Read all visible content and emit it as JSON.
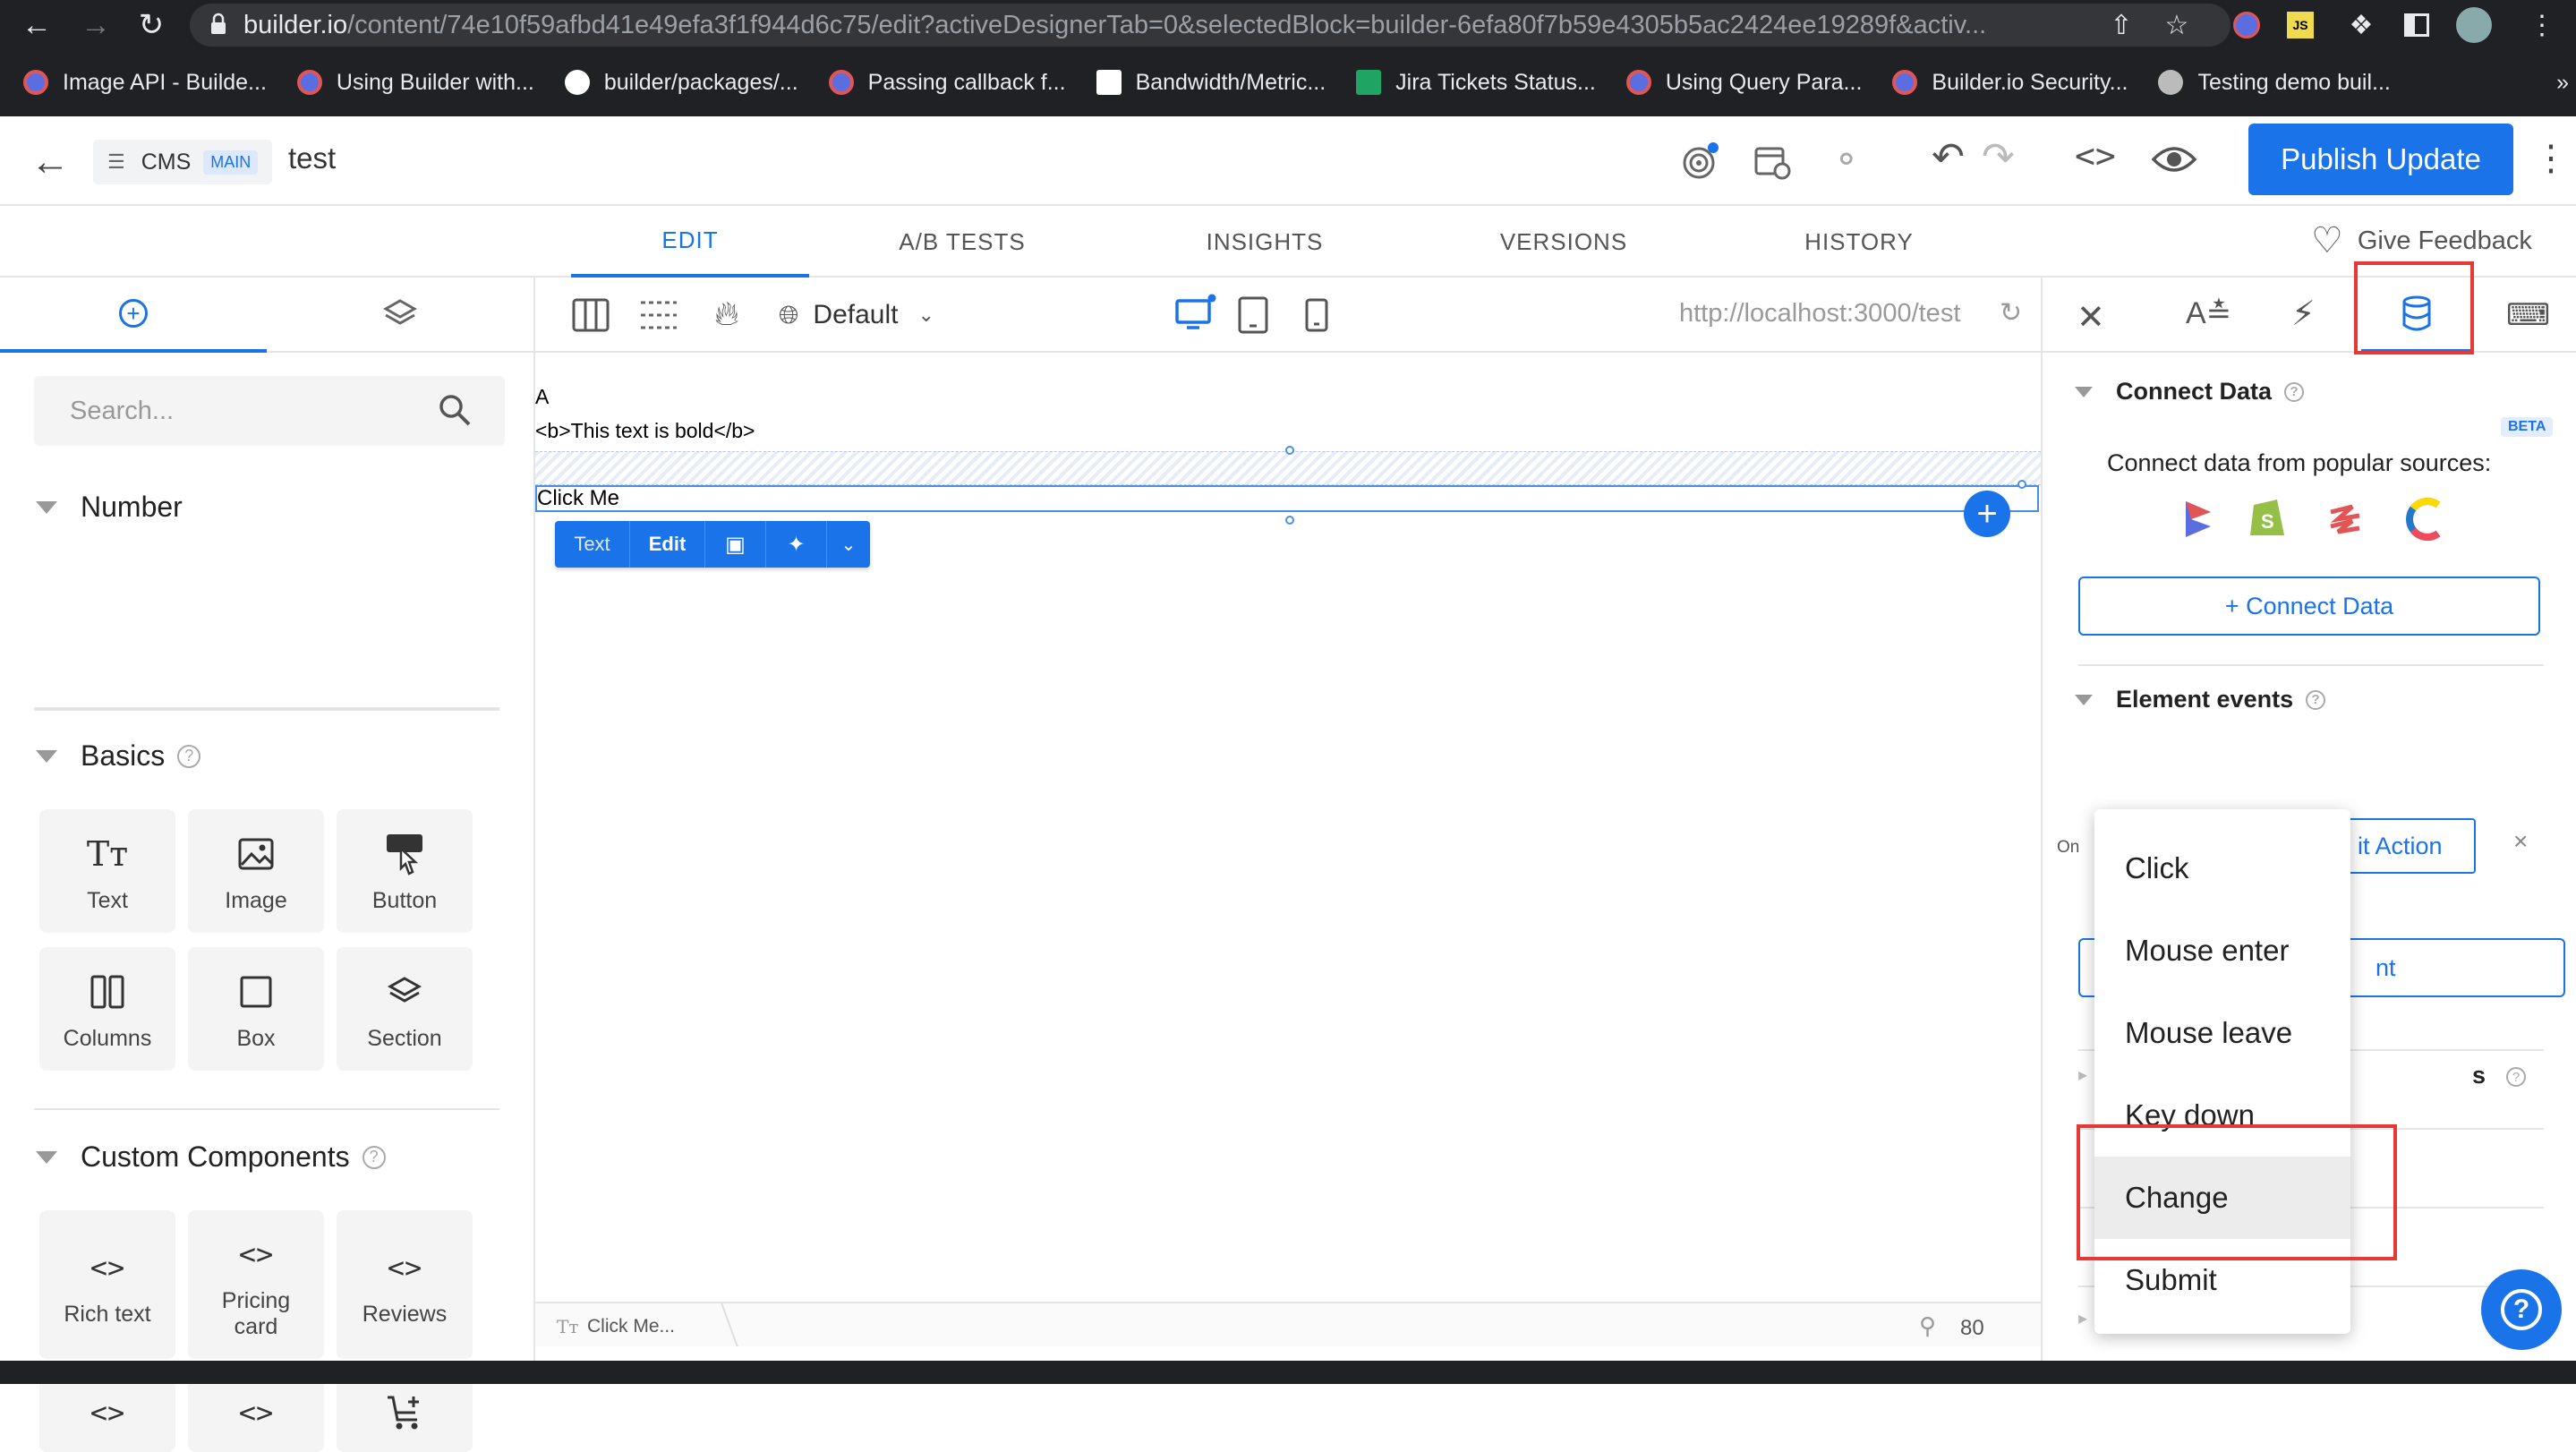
{
  "browser": {
    "url_host": "builder.io",
    "url_path": "/content/74e10f59afbd41e49efa3f1f944d6c75/edit?activeDesignerTab=0&selectedBlock=builder-6efa80f7b59e4305b5ac2424ee19289f&activ...",
    "bookmarks": [
      {
        "label": "Image API - Builde...",
        "color": "#e25555"
      },
      {
        "label": "Using Builder with...",
        "color": "#e25555"
      },
      {
        "label": "builder/packages/...",
        "color": "#ffffff"
      },
      {
        "label": "Passing callback f...",
        "color": "#e25555"
      },
      {
        "label": "Bandwidth/Metric...",
        "color": "#ffffff"
      },
      {
        "label": "Jira Tickets Status...",
        "color": "#1fa463"
      },
      {
        "label": "Using Query Para...",
        "color": "#e25555"
      },
      {
        "label": "Builder.io Security...",
        "color": "#e25555"
      },
      {
        "label": "Testing demo buil...",
        "color": "#bbbbbb"
      }
    ],
    "more": "»"
  },
  "header": {
    "cms_label": "CMS",
    "main_badge": "MAIN",
    "title": "test",
    "publish_label": "Publish Update",
    "accent": "#1a73e8"
  },
  "tabs": [
    "EDIT",
    "A/B TESTS",
    "INSIGHTS",
    "VERSIONS",
    "HISTORY"
  ],
  "feedback_label": "Give Feedback",
  "left": {
    "search_placeholder": "Search...",
    "number_heading": "Number",
    "basics_heading": "Basics",
    "basics": [
      "Text",
      "Image",
      "Button",
      "Columns",
      "Box",
      "Section"
    ],
    "custom_heading": "Custom Components",
    "custom": [
      "Rich text",
      "Pricing card",
      "Reviews"
    ]
  },
  "canvas": {
    "device_label": "Default",
    "preview_url": "http://localhost:3000/test",
    "line_a": "A",
    "line_bold": "<b>This text is bold</b>",
    "click_me": "Click Me",
    "toolbar": {
      "text": "Text",
      "edit": "Edit"
    },
    "status_block": "Click Me...",
    "zoom": "80"
  },
  "right": {
    "connect_heading": "Connect Data",
    "beta": "BETA",
    "connect_desc": "Connect data from popular sources:",
    "connect_button": "+ Connect Data",
    "events_heading": "Element events",
    "on_label": "On",
    "edit_action_partial": "it Action",
    "second_partial": "nt",
    "hidden_partial": "s"
  },
  "event_menu": {
    "items": [
      "Click",
      "Mouse enter",
      "Mouse leave",
      "Key down",
      "Change",
      "Submit"
    ],
    "highlighted": "Change"
  }
}
